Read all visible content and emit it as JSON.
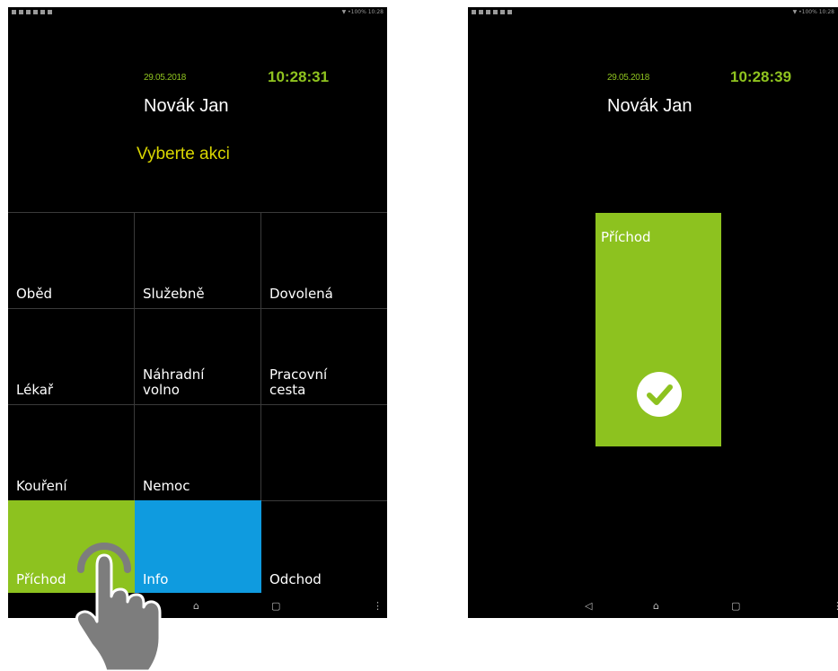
{
  "colors": {
    "accent_green": "#8dc21f",
    "info_blue": "#0f9bdf",
    "prompt_yellow": "#d9d600",
    "background": "#000000"
  },
  "left_screen": {
    "status_right": "▼ •100% 10:28",
    "date": "29.05.2018",
    "time": "10:28:31",
    "user_name": "Novák Jan",
    "prompt": "Vyberte akci",
    "tiles": [
      {
        "label": "Oběd"
      },
      {
        "label": "Služebně"
      },
      {
        "label": "Dovolená"
      },
      {
        "label": "Lékař"
      },
      {
        "label": "Náhradní\nvolno"
      },
      {
        "label": "Pracovní\ncesta"
      },
      {
        "label": "Kouření"
      },
      {
        "label": "Nemoc"
      },
      {
        "label": ""
      },
      {
        "label": "Příchod",
        "color": "#8dc21f"
      },
      {
        "label": "Info",
        "color": "#0f9bdf"
      },
      {
        "label": "Odchod"
      }
    ],
    "nav": {
      "back": "◁",
      "home": "⌂",
      "recents": "▢",
      "menu": "⋮"
    }
  },
  "right_screen": {
    "status_right": "▼ •100% 10:28",
    "date": "29.05.2018",
    "time": "10:28:39",
    "user_name": "Novák Jan",
    "confirmed_action": "Příchod",
    "confirm_icon": "checkmark-circle-icon",
    "nav": {
      "back": "◁",
      "home": "⌂",
      "recents": "▢",
      "menu": "⋮"
    }
  },
  "overlay": {
    "icon": "hand-tap-gesture-icon"
  }
}
